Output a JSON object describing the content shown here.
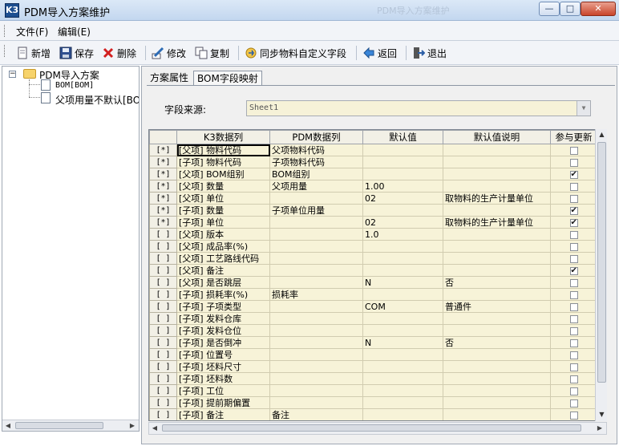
{
  "window": {
    "title": "PDM导入方案维护",
    "ghost_title": "PDM导入方案维护",
    "app_icon": "K3",
    "min_glyph": "—",
    "max_glyph": "□",
    "close_glyph": "✕"
  },
  "menu": {
    "file": "文件(F)",
    "edit": "编辑(E)"
  },
  "toolbar": {
    "new": "新增",
    "save": "保存",
    "delete": "删除",
    "modify": "修改",
    "copy": "复制",
    "sync": "同步物料自定义字段",
    "back": "返回",
    "exit": "退出"
  },
  "tree": {
    "root_expander": "−",
    "root": "PDM导入方案",
    "child1": "BOM[BOM]",
    "child2": "父项用量不默认[BO"
  },
  "tabs": {
    "properties": "方案属性",
    "mapping": "BOM字段映射"
  },
  "source": {
    "label": "字段来源:",
    "value": "Sheet1",
    "dropdown_glyph": "▼"
  },
  "scroll_glyphs": {
    "left": "◀",
    "right": "▶",
    "up": "▲",
    "down": "▼"
  },
  "grid": {
    "columns": [
      "K3数据列",
      "PDM数据列",
      "默认值",
      "默认值说明",
      "参与更新"
    ],
    "rows": [
      {
        "flag": "[*]",
        "k3": "[父项] 物料代码",
        "pdm": "父项物料代码",
        "def": "",
        "desc": "",
        "chk": false
      },
      {
        "flag": "[*]",
        "k3": "[子项] 物料代码",
        "pdm": "子项物料代码",
        "def": "",
        "desc": "",
        "chk": false
      },
      {
        "flag": "[*]",
        "k3": "[父项] BOM组别",
        "pdm": "BOM组别",
        "def": "",
        "desc": "",
        "chk": true
      },
      {
        "flag": "[*]",
        "k3": "[父项] 数量",
        "pdm": "父项用量",
        "def": "1.00",
        "desc": "",
        "chk": false
      },
      {
        "flag": "[*]",
        "k3": "[父项] 单位",
        "pdm": "",
        "def": "02",
        "desc": "取物料的生产计量单位",
        "chk": false
      },
      {
        "flag": "[*]",
        "k3": "[子项] 数量",
        "pdm": "子项单位用量",
        "def": "",
        "desc": "",
        "chk": true
      },
      {
        "flag": "[*]",
        "k3": "[子项] 单位",
        "pdm": "",
        "def": "02",
        "desc": "取物料的生产计量单位",
        "chk": true
      },
      {
        "flag": "[ ]",
        "k3": "[父项] 版本",
        "pdm": "",
        "def": "1.0",
        "desc": "",
        "chk": false
      },
      {
        "flag": "[ ]",
        "k3": "[父项] 成品率(%)",
        "pdm": "",
        "def": "",
        "desc": "",
        "chk": false
      },
      {
        "flag": "[ ]",
        "k3": "[父项] 工艺路线代码",
        "pdm": "",
        "def": "",
        "desc": "",
        "chk": false
      },
      {
        "flag": "[ ]",
        "k3": "[父项] 备注",
        "pdm": "",
        "def": "",
        "desc": "",
        "chk": true
      },
      {
        "flag": "[ ]",
        "k3": "[父项] 是否跳层",
        "pdm": "",
        "def": "N",
        "desc": "否",
        "chk": false
      },
      {
        "flag": "[ ]",
        "k3": "[子项] 损耗率(%)",
        "pdm": "损耗率",
        "def": "",
        "desc": "",
        "chk": false
      },
      {
        "flag": "[ ]",
        "k3": "[子项] 子项类型",
        "pdm": "",
        "def": "COM",
        "desc": "普通件",
        "chk": false
      },
      {
        "flag": "[ ]",
        "k3": "[子项] 发料仓库",
        "pdm": "",
        "def": "",
        "desc": "",
        "chk": false
      },
      {
        "flag": "[ ]",
        "k3": "[子项] 发料仓位",
        "pdm": "",
        "def": "",
        "desc": "",
        "chk": false
      },
      {
        "flag": "[ ]",
        "k3": "[子项] 是否倒冲",
        "pdm": "",
        "def": "N",
        "desc": "否",
        "chk": false
      },
      {
        "flag": "[ ]",
        "k3": "[子项] 位置号",
        "pdm": "",
        "def": "",
        "desc": "",
        "chk": false
      },
      {
        "flag": "[ ]",
        "k3": "[子项] 坯料尺寸",
        "pdm": "",
        "def": "",
        "desc": "",
        "chk": false
      },
      {
        "flag": "[ ]",
        "k3": "[子项] 坯料数",
        "pdm": "",
        "def": "",
        "desc": "",
        "chk": false
      },
      {
        "flag": "[ ]",
        "k3": "[子项] 工位",
        "pdm": "",
        "def": "",
        "desc": "",
        "chk": false
      },
      {
        "flag": "[ ]",
        "k3": "[子项] 提前期偏置",
        "pdm": "",
        "def": "",
        "desc": "",
        "chk": false
      },
      {
        "flag": "[ ]",
        "k3": "[子项] 备注",
        "pdm": "备注",
        "def": "",
        "desc": "",
        "chk": false
      }
    ]
  }
}
